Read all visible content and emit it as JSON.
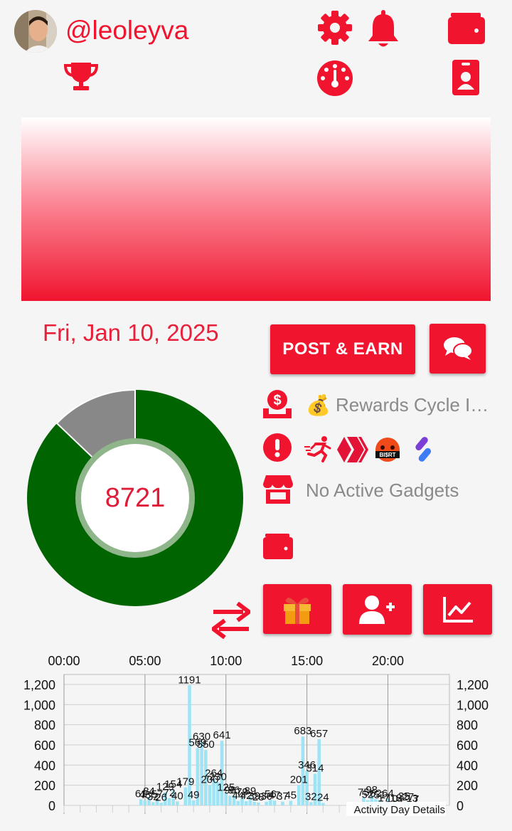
{
  "header": {
    "username": "@leoleyva",
    "icons": [
      "avatar",
      "trophy-icon",
      "gear-icon",
      "bell-icon",
      "dashboard-icon",
      "wallet-icon",
      "id-badge-icon"
    ]
  },
  "main": {
    "date": "Fri, Jan 10, 2025",
    "post_button_label": "POST & EARN",
    "donut_value": "8721",
    "rewards_text": "Rewards Cycle I…",
    "rewards_emoji": "💰",
    "gadgets_text": "No Active Gadgets",
    "donut_slices": [
      {
        "color": "#006400",
        "fraction": 0.88
      },
      {
        "color": "#888888",
        "fraction": 0.12
      }
    ],
    "badge_label": "BI$RT"
  },
  "colors": {
    "accent": "#f0142e",
    "donut_main": "#006400",
    "donut_rest": "#888888",
    "bar": "#9fe4f5"
  },
  "chart_data": {
    "type": "bar",
    "title": "",
    "legend": "Activity Day Details",
    "x_tick_labels": [
      "00:00",
      "05:00",
      "10:00",
      "15:00",
      "20:00"
    ],
    "y_tick_labels": [
      "0",
      "200",
      "400",
      "600",
      "800",
      "1,000",
      "1,200"
    ],
    "ylim": [
      0,
      1300
    ],
    "xlim": [
      0,
      24
    ],
    "grid": true,
    "bars": [
      {
        "x": 4.75,
        "y": 61
      },
      {
        "x": 5.0,
        "y": 48
      },
      {
        "x": 5.25,
        "y": 84
      },
      {
        "x": 5.5,
        "y": 32
      },
      {
        "x": 5.75,
        "y": 57
      },
      {
        "x": 6.0,
        "y": 26
      },
      {
        "x": 6.25,
        "y": 129
      },
      {
        "x": 6.5,
        "y": 72
      },
      {
        "x": 6.75,
        "y": 154
      },
      {
        "x": 7.0,
        "y": 40
      },
      {
        "x": 7.5,
        "y": 179
      },
      {
        "x": 7.75,
        "y": 1191
      },
      {
        "x": 8.0,
        "y": 49
      },
      {
        "x": 8.25,
        "y": 569
      },
      {
        "x": 8.5,
        "y": 630
      },
      {
        "x": 8.75,
        "y": 550
      },
      {
        "x": 9.0,
        "y": 200
      },
      {
        "x": 9.25,
        "y": 264
      },
      {
        "x": 9.5,
        "y": 230
      },
      {
        "x": 9.75,
        "y": 641
      },
      {
        "x": 10.0,
        "y": 125
      },
      {
        "x": 10.25,
        "y": 96
      },
      {
        "x": 10.5,
        "y": 96
      },
      {
        "x": 10.75,
        "y": 44
      },
      {
        "x": 11.0,
        "y": 79
      },
      {
        "x": 11.25,
        "y": 42
      },
      {
        "x": 11.5,
        "y": 89
      },
      {
        "x": 11.75,
        "y": 39
      },
      {
        "x": 12.0,
        "y": 28
      },
      {
        "x": 12.5,
        "y": 36
      },
      {
        "x": 12.75,
        "y": 56
      },
      {
        "x": 13.0,
        "y": 47
      },
      {
        "x": 13.5,
        "y": 37
      },
      {
        "x": 14.0,
        "y": 45
      },
      {
        "x": 14.5,
        "y": 201
      },
      {
        "x": 14.75,
        "y": 683
      },
      {
        "x": 15.0,
        "y": 346
      },
      {
        "x": 15.25,
        "y": 32
      },
      {
        "x": 15.5,
        "y": 314
      },
      {
        "x": 15.75,
        "y": 657
      },
      {
        "x": 16.0,
        "y": 24
      },
      {
        "x": 18.5,
        "y": 75
      },
      {
        "x": 18.75,
        "y": 52
      },
      {
        "x": 19.0,
        "y": 98
      },
      {
        "x": 19.25,
        "y": 62
      },
      {
        "x": 19.5,
        "y": 51
      },
      {
        "x": 19.75,
        "y": 17
      },
      {
        "x": 20.0,
        "y": 64
      },
      {
        "x": 20.25,
        "y": 10
      },
      {
        "x": 20.5,
        "y": 18
      },
      {
        "x": 20.75,
        "y": 4
      },
      {
        "x": 21.0,
        "y": 35
      },
      {
        "x": 21.25,
        "y": 27
      },
      {
        "x": 21.5,
        "y": 13
      },
      {
        "x": 21.75,
        "y": 7
      }
    ]
  }
}
